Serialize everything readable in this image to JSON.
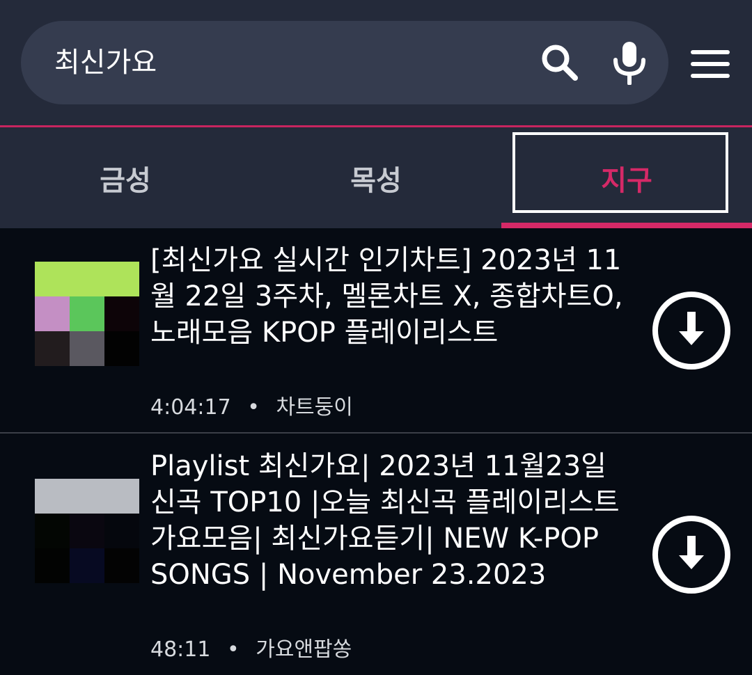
{
  "search": {
    "query": "최신가요"
  },
  "icons": {
    "search": "search-icon",
    "mic": "microphone-icon",
    "menu": "hamburger-menu-icon",
    "download": "download-circle-icon"
  },
  "colors": {
    "accent": "#d52967",
    "header_bg": "#242a3a",
    "search_bg": "#353c4f",
    "page_bg": "#060b13"
  },
  "tabs": [
    {
      "label": "금성",
      "selected": false
    },
    {
      "label": "목성",
      "selected": false
    },
    {
      "label": "지구",
      "selected": true
    }
  ],
  "results": [
    {
      "title": "[최신가요 실시간 인기차트] 2023년 11월 22일 3주차, 멜론차트 X, 종합차트O, 노래모음 KPOP 플레이리스트",
      "duration": "4:04:17",
      "separator": "•",
      "channel": "차트둥이",
      "thumbnail_colors": [
        "#aee35a",
        "#aee35a",
        "#aee35a",
        "#c48fc4",
        "#5bc65b",
        "#0d0408",
        "#221c1e",
        "#5a5860",
        "#020202"
      ]
    },
    {
      "title": "Playlist 최신가요| 2023년 11월23일 신곡 TOP10 |오늘 최신곡 플레이리스트 가요모음| 최신가요듣기| NEW K-POP SONGS | November 23.2023",
      "duration": "48:11",
      "separator": "•",
      "channel": "가요앤팝쏭",
      "thumbnail_colors": [
        "#b9bcc2",
        "#b9bcc2",
        "#b9bcc2",
        "#030603",
        "#0a0710",
        "#05070d",
        "#020302",
        "#070a22",
        "#030303"
      ]
    }
  ]
}
